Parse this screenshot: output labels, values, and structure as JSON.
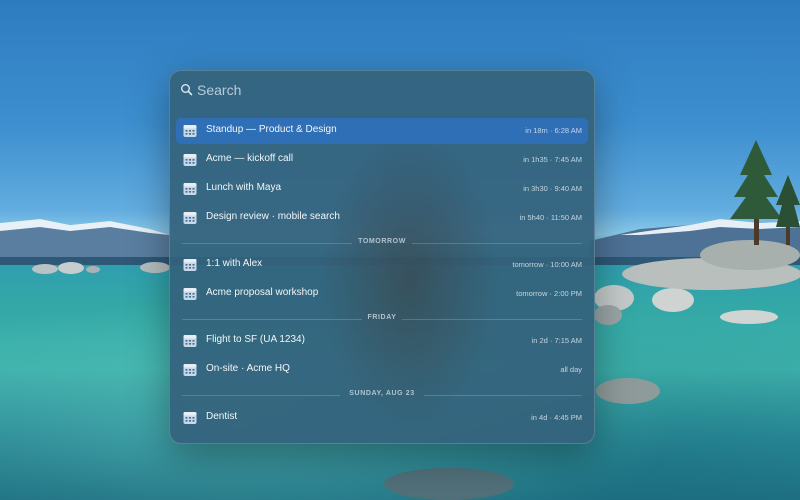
{
  "search": {
    "placeholder": "Search"
  },
  "results": [
    {
      "title": "Standup — Product & Design",
      "time": "in 18m · 6:28 AM",
      "selected": true,
      "icon": "calendar-icon"
    },
    {
      "title": "Acme — kickoff call",
      "time": "in 1h35 · 7:45 AM",
      "icon": "calendar-icon"
    },
    {
      "title": "Lunch with Maya",
      "time": "in 3h30 · 9:40 AM",
      "icon": "calendar-icon"
    },
    {
      "title": "Design review · mobile search",
      "time": "in 5h40 · 11:50 AM",
      "icon": "calendar-icon"
    },
    {
      "title": "1:1 with Alex",
      "time": "tomorrow · 10:00 AM",
      "icon": "calendar-icon"
    },
    {
      "title": "Acme proposal workshop",
      "time": "tomorrow · 2:00 PM",
      "icon": "calendar-icon"
    },
    {
      "title": "Flight to SF (UA 1234)",
      "time": "in 2d · 7:15 AM",
      "icon": "calendar-icon"
    },
    {
      "title": "On-site · Acme HQ",
      "time": "all day",
      "icon": "calendar-icon"
    },
    {
      "title": "Dentist",
      "time": "in 4d · 4:45 PM",
      "icon": "calendar-icon"
    }
  ],
  "sections": {
    "tomorrow": "TOMORROW",
    "friday": "FRIDAY",
    "sunday": "SUNDAY, AUG 23"
  },
  "colors": {
    "selection": "#2f6fb6",
    "panel": "#34627c"
  }
}
